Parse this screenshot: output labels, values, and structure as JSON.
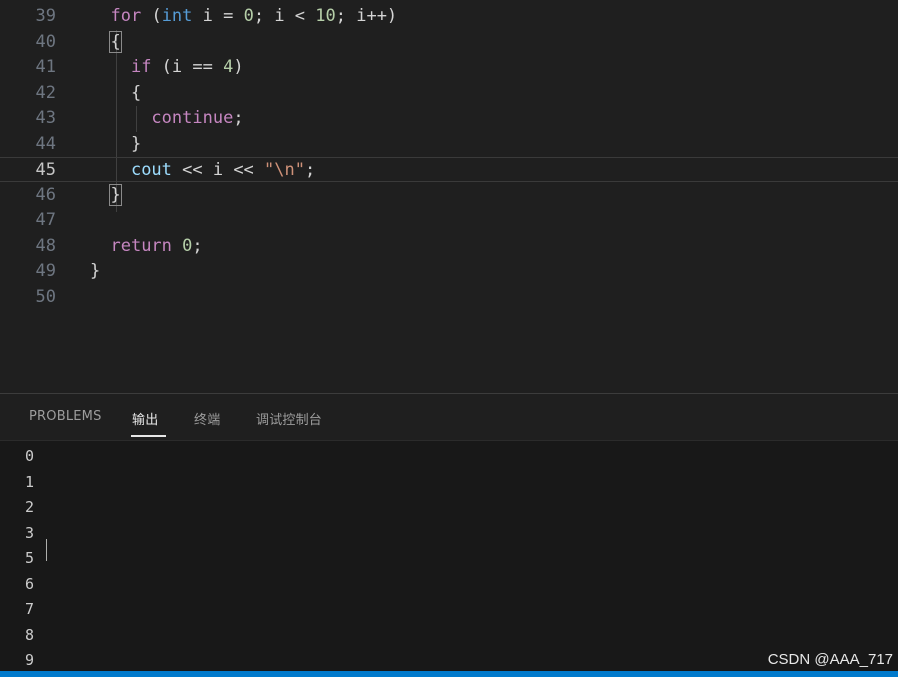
{
  "editor": {
    "lines": [
      {
        "num": "39",
        "tokens": [
          {
            "t": "  ",
            "c": "id"
          },
          {
            "t": "for",
            "c": "kw"
          },
          {
            "t": " (",
            "c": "id"
          },
          {
            "t": "int",
            "c": "ty"
          },
          {
            "t": " i = ",
            "c": "id"
          },
          {
            "t": "0",
            "c": "num"
          },
          {
            "t": "; i < ",
            "c": "id"
          },
          {
            "t": "10",
            "c": "num"
          },
          {
            "t": "; i++)",
            "c": "id"
          }
        ]
      },
      {
        "num": "40",
        "tokens": [
          {
            "t": "  ",
            "c": "id"
          },
          {
            "t": "{",
            "c": "id",
            "box": true
          }
        ]
      },
      {
        "num": "41",
        "tokens": [
          {
            "t": "    ",
            "c": "id"
          },
          {
            "t": "if",
            "c": "kw"
          },
          {
            "t": " (i == ",
            "c": "id"
          },
          {
            "t": "4",
            "c": "num"
          },
          {
            "t": ")",
            "c": "id"
          }
        ]
      },
      {
        "num": "42",
        "tokens": [
          {
            "t": "    {",
            "c": "id"
          }
        ]
      },
      {
        "num": "43",
        "tokens": [
          {
            "t": "      ",
            "c": "id"
          },
          {
            "t": "continue",
            "c": "kw"
          },
          {
            "t": ";",
            "c": "id"
          }
        ]
      },
      {
        "num": "44",
        "tokens": [
          {
            "t": "    }",
            "c": "id"
          }
        ]
      },
      {
        "num": "45",
        "tokens": [
          {
            "t": "    ",
            "c": "id"
          },
          {
            "t": "cout",
            "c": "var"
          },
          {
            "t": " << i << ",
            "c": "id"
          },
          {
            "t": "\"\\n\"",
            "c": "str"
          },
          {
            "t": ";",
            "c": "id"
          }
        ],
        "active": true
      },
      {
        "num": "46",
        "tokens": [
          {
            "t": "  ",
            "c": "id"
          },
          {
            "t": "}",
            "c": "id",
            "box": true
          }
        ]
      },
      {
        "num": "47",
        "tokens": []
      },
      {
        "num": "48",
        "tokens": [
          {
            "t": "  ",
            "c": "id"
          },
          {
            "t": "return",
            "c": "kw"
          },
          {
            "t": " ",
            "c": "id"
          },
          {
            "t": "0",
            "c": "num"
          },
          {
            "t": ";",
            "c": "id"
          }
        ]
      },
      {
        "num": "49",
        "tokens": [
          {
            "t": "}",
            "c": "id"
          }
        ]
      },
      {
        "num": "50",
        "tokens": []
      }
    ]
  },
  "panel": {
    "tabs": [
      {
        "label": "PROBLEMS",
        "active": false
      },
      {
        "label": "输出",
        "active": true
      },
      {
        "label": "终端",
        "active": false
      },
      {
        "label": "调试控制台",
        "active": false
      }
    ],
    "output_lines": [
      "0",
      "1",
      "2",
      "3",
      "5",
      "6",
      "7",
      "8",
      "9"
    ]
  },
  "colors": {
    "editor_bg": "#1f1f1f",
    "output_bg": "#181818",
    "status_bar": "#007acc",
    "keyword": "#c586c0",
    "type": "#569cd6",
    "number": "#b5cea8",
    "string": "#ce9178"
  },
  "watermark": "CSDN @AAA_717"
}
